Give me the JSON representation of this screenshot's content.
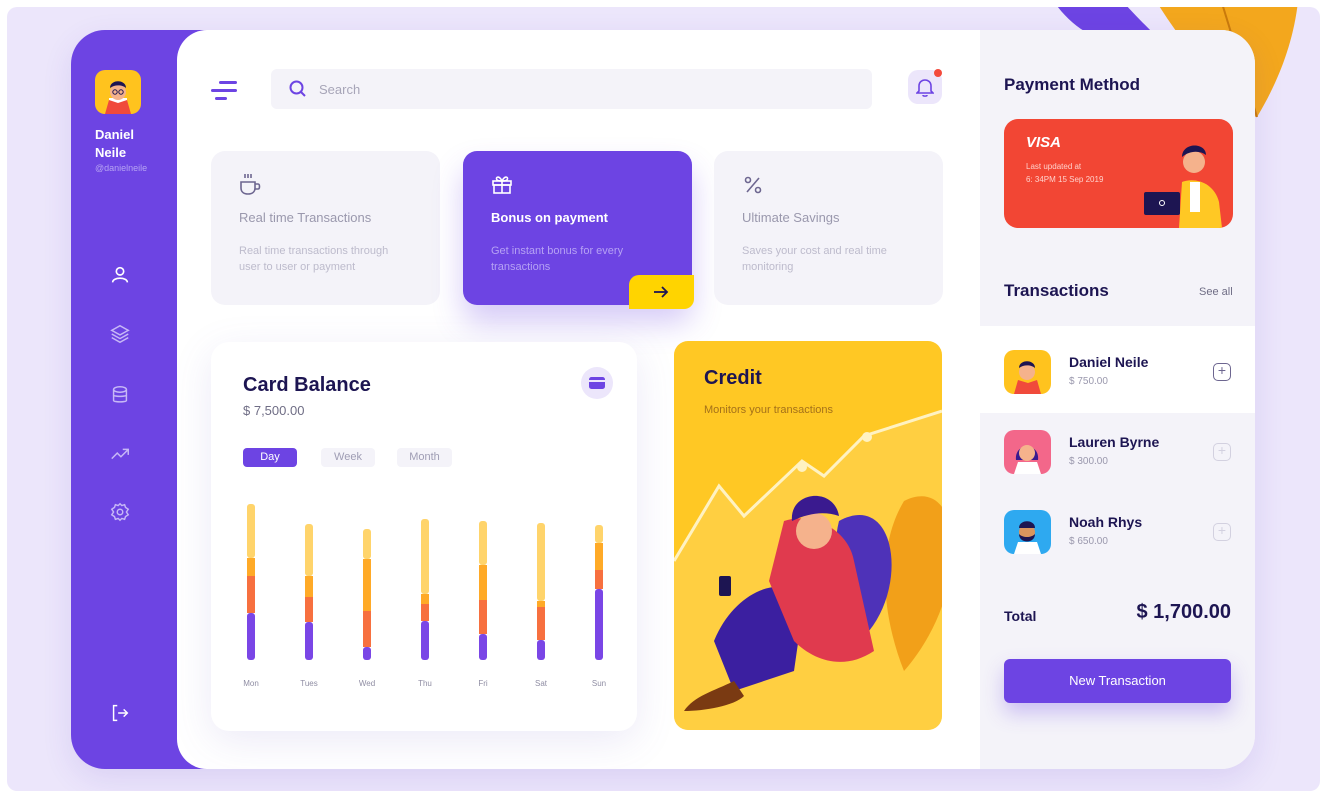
{
  "profile": {
    "first_name": "Daniel",
    "last_name": "Neile",
    "handle": "@danielneile"
  },
  "search": {
    "placeholder": "Search"
  },
  "features": [
    {
      "title": "Real time Transactions",
      "desc": "Real time transactions through user to user or payment",
      "icon": "coffee-cup-icon"
    },
    {
      "title": "Bonus on payment",
      "desc": "Get instant bonus for every transactions",
      "icon": "gift-icon"
    },
    {
      "title": "Ultimate Savings",
      "desc": "Saves your cost and real time monitoring",
      "icon": "percent-icon"
    }
  ],
  "balance": {
    "title": "Card Balance",
    "amount": "$ 7,500.00",
    "tabs": [
      "Day",
      "Week",
      "Month"
    ],
    "active_tab": "Day"
  },
  "chart_data": {
    "type": "bar",
    "stacked": true,
    "categories": [
      "Mon",
      "Tues",
      "Wed",
      "Thu",
      "Fri",
      "Sat",
      "Sun"
    ],
    "series": [
      {
        "values": [
          47,
          38,
          13,
          39,
          26,
          20,
          71
        ],
        "color": "#7a46e6"
      },
      {
        "values": [
          37,
          25,
          36,
          17,
          34,
          33,
          19
        ],
        "color": "#f7703f"
      },
      {
        "values": [
          18,
          21,
          52,
          10,
          35,
          6,
          27
        ],
        "color": "#ffaa27"
      },
      {
        "values": [
          54,
          52,
          30,
          75,
          44,
          78,
          18
        ],
        "color": "#ffd46b"
      }
    ]
  },
  "credit": {
    "title": "Credit",
    "subtitle": "Monitors your transactions"
  },
  "payment": {
    "title": "Payment Method",
    "card_brand": "VISA",
    "updated_label": "Last updated at",
    "updated_time": "6: 34PM 15 Sep 2019"
  },
  "transactions": {
    "title": "Transactions",
    "see_all": "See all",
    "items": [
      {
        "name": "Daniel Neile",
        "amount": "$ 750.00"
      },
      {
        "name": "Lauren Byrne",
        "amount": "$ 300.00"
      },
      {
        "name": "Noah Rhys",
        "amount": "$ 650.00"
      }
    ],
    "total_label": "Total",
    "total_value": "$ 1,700.00",
    "new_button": "New Transaction"
  },
  "colors": {
    "primary": "#6d44e3",
    "accent_yellow": "#ffc824",
    "card_red": "#f24634",
    "notification": "#f34a3c"
  }
}
